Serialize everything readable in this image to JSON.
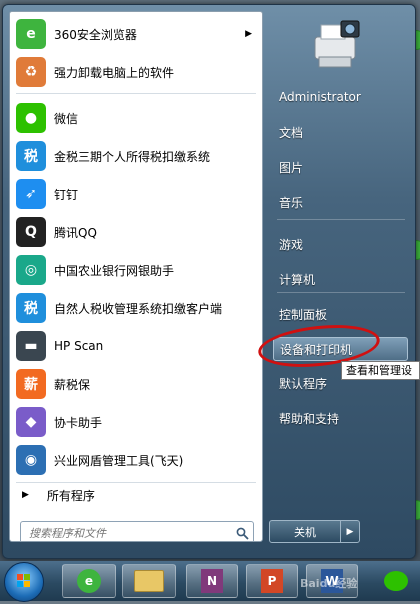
{
  "programs": [
    {
      "label": "360安全浏览器",
      "icon": "360-browser-icon",
      "color": "#3eb43e",
      "glyph": "e",
      "submenu": true
    },
    {
      "label": "强力卸载电脑上的软件",
      "icon": "uninstall-icon",
      "color": "#e07b39",
      "glyph": "♻",
      "submenu": false
    },
    {
      "label": "微信",
      "icon": "wechat-icon",
      "color": "#2dc100",
      "glyph": "●",
      "submenu": false
    },
    {
      "label": "金税三期个人所得税扣缴系统",
      "icon": "tax-icon",
      "color": "#1f8fdc",
      "glyph": "税",
      "submenu": false
    },
    {
      "label": "钉钉",
      "icon": "dingtalk-icon",
      "color": "#1e8ef0",
      "glyph": "➶",
      "submenu": false
    },
    {
      "label": "腾讯QQ",
      "icon": "qq-icon",
      "color": "#222222",
      "glyph": "Q",
      "submenu": false
    },
    {
      "label": "中国农业银行网银助手",
      "icon": "abc-bank-icon",
      "color": "#1aa88a",
      "glyph": "◎",
      "submenu": false
    },
    {
      "label": "自然人税收管理系统扣缴客户端",
      "icon": "tax-client-icon",
      "color": "#1f8fdc",
      "glyph": "税",
      "submenu": false
    },
    {
      "label": "HP Scan",
      "icon": "scanner-icon",
      "color": "#3a4650",
      "glyph": "▬",
      "submenu": false
    },
    {
      "label": "薪税保",
      "icon": "xinshuibao-icon",
      "color": "#f26a21",
      "glyph": "薪",
      "submenu": false
    },
    {
      "label": "协卡助手",
      "icon": "xieka-icon",
      "color": "#7a5cc9",
      "glyph": "◆",
      "submenu": false
    },
    {
      "label": "兴业网盾管理工具(飞天)",
      "icon": "feitian-icon",
      "color": "#2c6fb3",
      "glyph": "◉",
      "submenu": false
    }
  ],
  "all_programs": "所有程序",
  "search_placeholder": "搜索程序和文件",
  "right_items": [
    {
      "label": "Administrator",
      "name": "user-folder"
    },
    {
      "label": "文档",
      "name": "documents"
    },
    {
      "label": "图片",
      "name": "pictures"
    },
    {
      "label": "音乐",
      "name": "music"
    },
    {
      "label": "游戏",
      "name": "games"
    },
    {
      "label": "计算机",
      "name": "computer"
    },
    {
      "label": "控制面板",
      "name": "control-panel"
    },
    {
      "label": "设备和打印机",
      "name": "devices-and-printers"
    },
    {
      "label": "默认程序",
      "name": "default-programs"
    },
    {
      "label": "帮助和支持",
      "name": "help-and-support"
    }
  ],
  "shutdown_label": "关机",
  "tooltip": "查看和管理设",
  "taskbar_apps": [
    "360-browser",
    "file-explorer",
    "onenote",
    "powerpoint",
    "word"
  ],
  "watermark": "Baidu经验"
}
